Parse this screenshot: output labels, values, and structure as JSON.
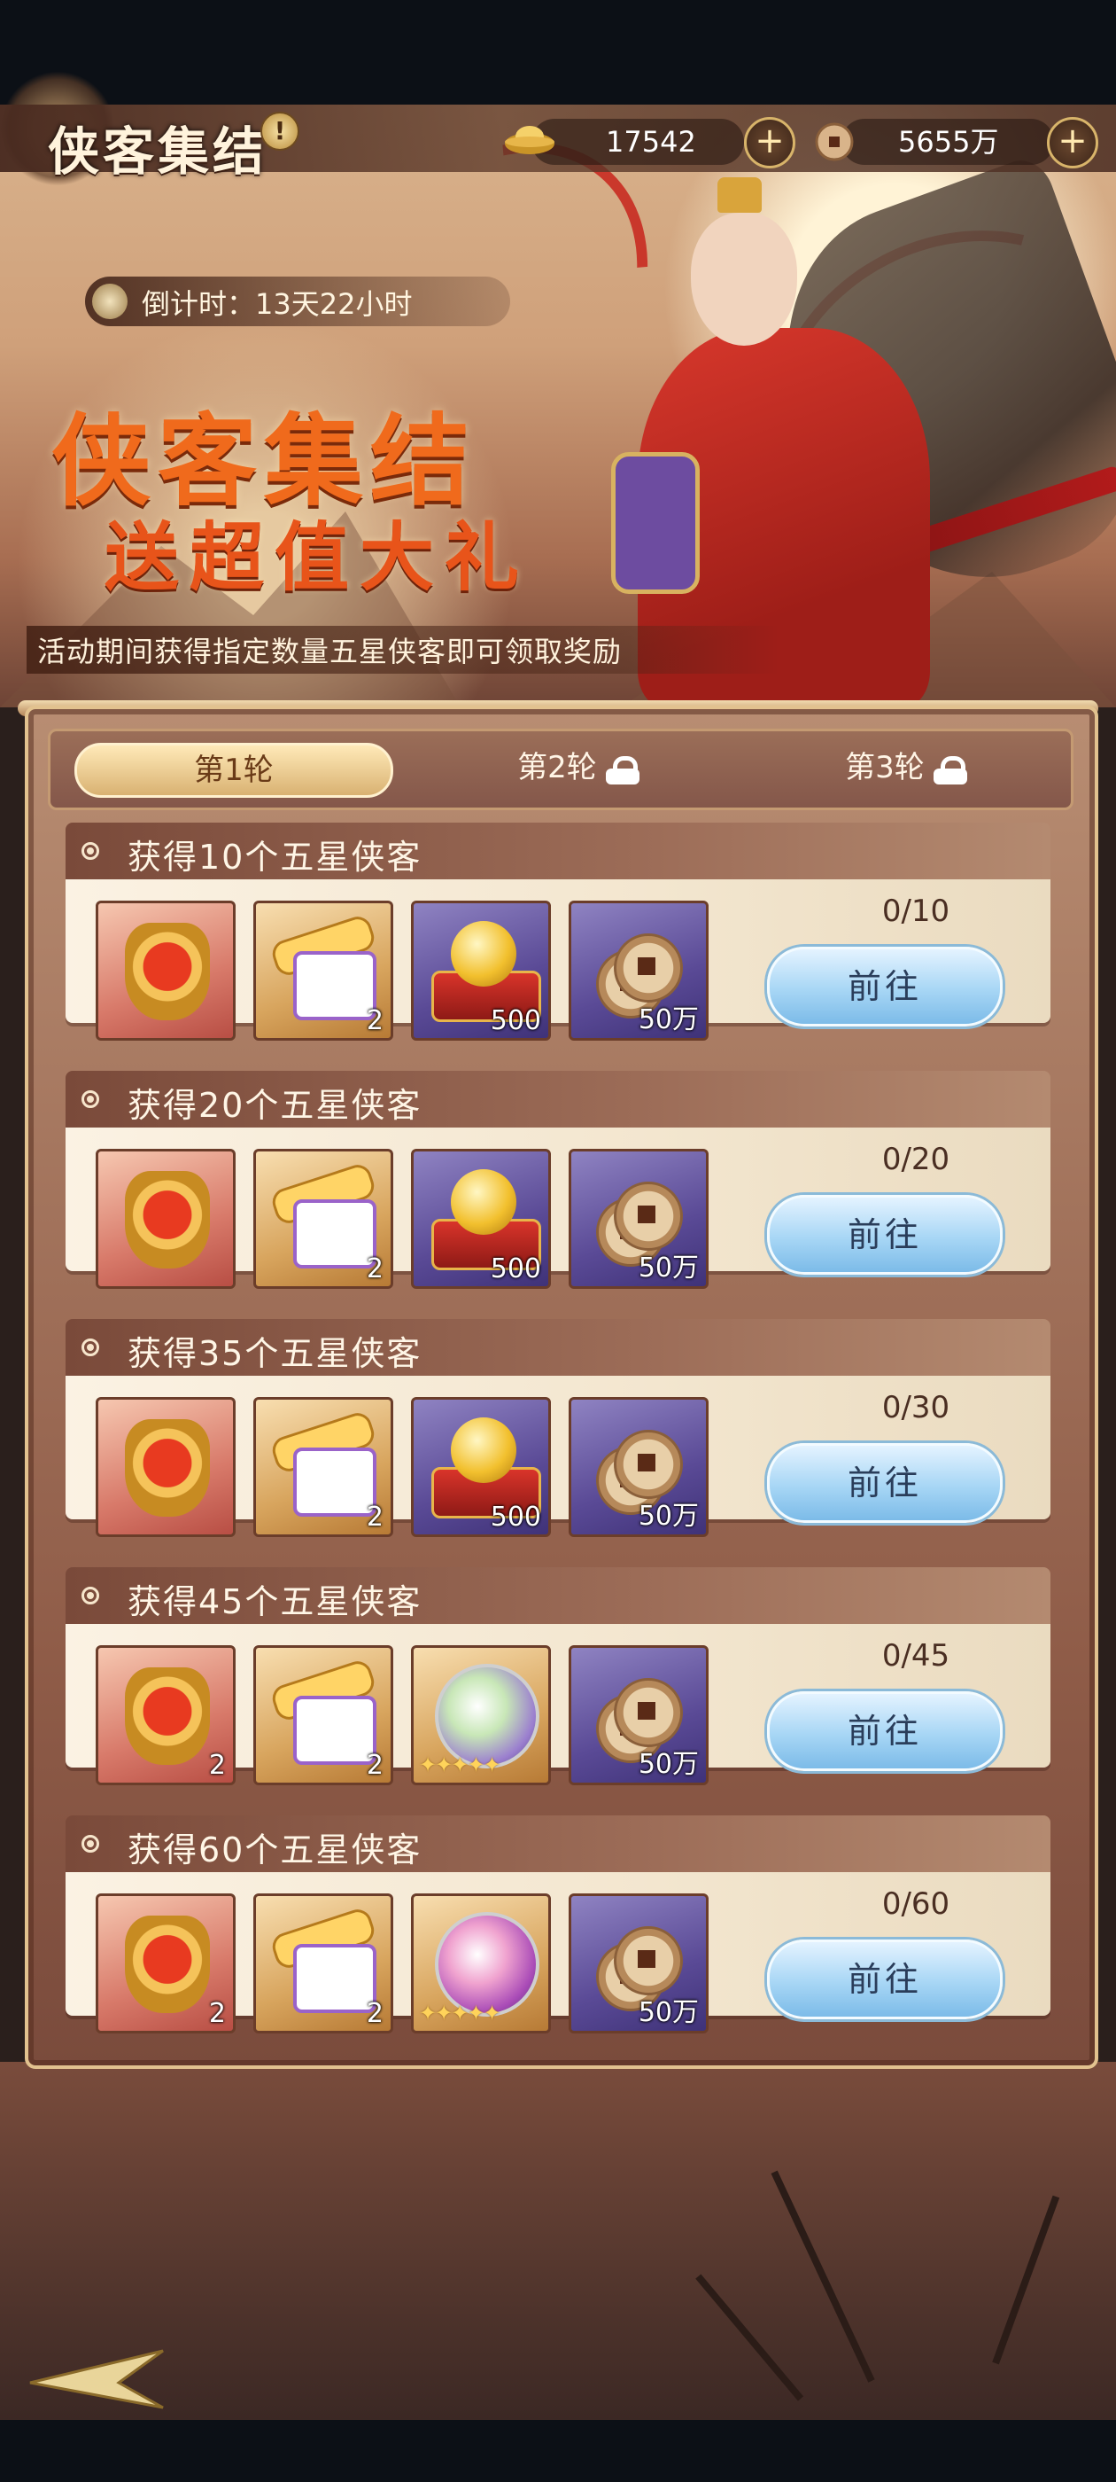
{
  "header": {
    "title": "侠客集结",
    "help_label": "!",
    "ingot_amount": "17542",
    "coin_amount": "5655万"
  },
  "banner": {
    "countdown": "倒计时：13天22小时",
    "title_line1": "侠客集结",
    "title_line2": "送超值大礼",
    "subtitle": "活动期间获得指定数量五星侠客即可领取奖励"
  },
  "tabs": [
    {
      "label": "第1轮",
      "active": true,
      "locked": false
    },
    {
      "label": "第2轮",
      "active": false,
      "locked": true
    },
    {
      "label": "第3轮",
      "active": false,
      "locked": true
    }
  ],
  "tasks": [
    {
      "title": "获得10个五星侠客",
      "progress": "0/10",
      "button": "前往",
      "rewards": [
        {
          "icon": "red-token-icon",
          "count": ""
        },
        {
          "icon": "scroll-icon",
          "count": "2"
        },
        {
          "icon": "gold-orb-icon",
          "count": "500"
        },
        {
          "icon": "coins-icon",
          "count": "50万"
        }
      ]
    },
    {
      "title": "获得20个五星侠客",
      "progress": "0/20",
      "button": "前往",
      "rewards": [
        {
          "icon": "red-token-icon",
          "count": ""
        },
        {
          "icon": "scroll-icon",
          "count": "2"
        },
        {
          "icon": "gold-orb-icon",
          "count": "500"
        },
        {
          "icon": "coins-icon",
          "count": "50万"
        }
      ]
    },
    {
      "title": "获得35个五星侠客",
      "progress": "0/30",
      "button": "前往",
      "rewards": [
        {
          "icon": "red-token-icon",
          "count": ""
        },
        {
          "icon": "scroll-icon",
          "count": "2"
        },
        {
          "icon": "gold-orb-icon",
          "count": "500"
        },
        {
          "icon": "coins-icon",
          "count": "50万"
        }
      ]
    },
    {
      "title": "获得45个五星侠客",
      "progress": "0/45",
      "button": "前往",
      "rewards": [
        {
          "icon": "red-token-icon",
          "count": "2"
        },
        {
          "icon": "scroll-icon",
          "count": "2"
        },
        {
          "icon": "green-sphere-icon",
          "count": ""
        },
        {
          "icon": "coins-icon",
          "count": "50万"
        }
      ]
    },
    {
      "title": "获得60个五星侠客",
      "progress": "0/60",
      "button": "前往",
      "rewards": [
        {
          "icon": "red-token-icon",
          "count": "2"
        },
        {
          "icon": "scroll-icon",
          "count": "2"
        },
        {
          "icon": "pink-sphere-icon",
          "count": ""
        },
        {
          "icon": "coins-icon",
          "count": "50万"
        }
      ]
    }
  ],
  "colors": {
    "accent_orange": "#f06a1c",
    "button_blue": "#a7d6f5",
    "card_header": "#7a4a3a"
  }
}
